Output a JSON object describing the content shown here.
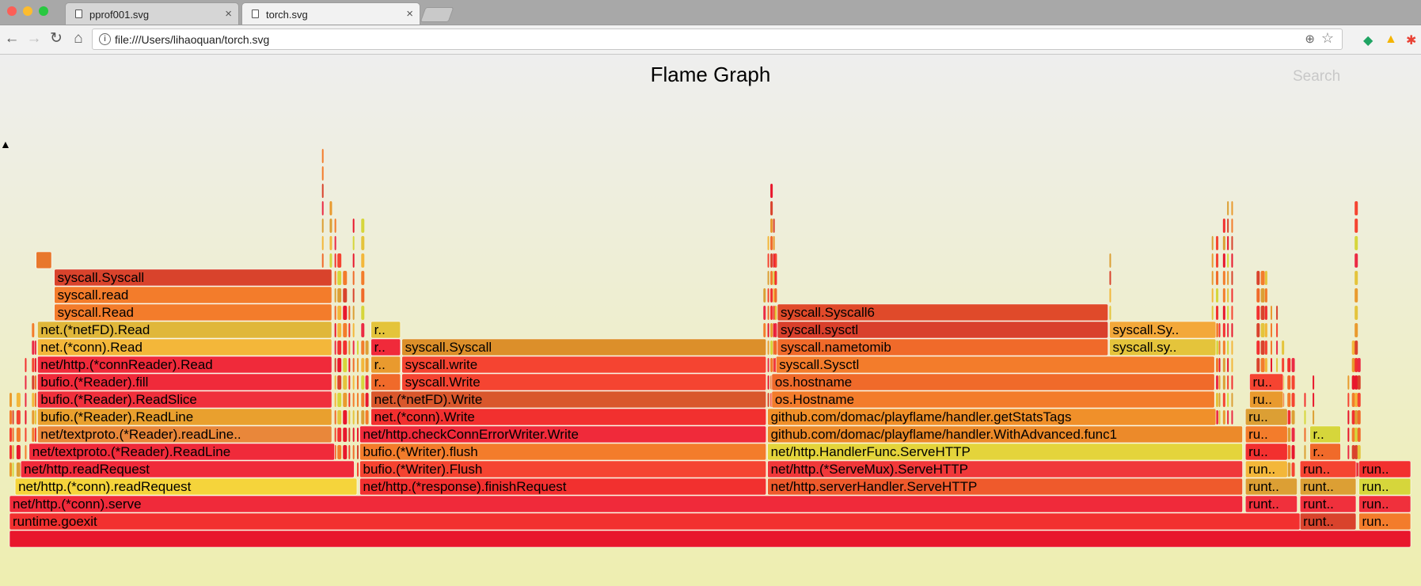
{
  "browser": {
    "tabs": [
      {
        "label": "pprof001.svg",
        "active": false
      },
      {
        "label": "torch.svg",
        "active": true
      }
    ],
    "url": "file:///Users/lihaoquan/torch.svg",
    "close_glyph": "×"
  },
  "flame": {
    "title": "Flame Graph",
    "search_label": "Search",
    "palette": [
      "#e8172c",
      "#f2302f",
      "#f54431",
      "#d9432c",
      "#f06a2a",
      "#f37c2b",
      "#e99a2e",
      "#dc9f34",
      "#f3b73a",
      "#e4c43b",
      "#d6d63b",
      "#eb2a44"
    ],
    "frames": [
      {
        "label": "",
        "level": 0,
        "start": 0.0,
        "width": 1.0,
        "color": "#e8172c"
      },
      {
        "label": "runtime.goexit",
        "level": 1,
        "start": 0.0,
        "width": 0.921,
        "color": "#f2302f"
      },
      {
        "label": "runt..",
        "level": 1,
        "start": 0.921,
        "width": 0.04,
        "color": "#d9432c"
      },
      {
        "label": "run..",
        "level": 1,
        "start": 0.963,
        "width": 0.037,
        "color": "#f37c2b"
      },
      {
        "label": "net/http.(*conn).serve",
        "level": 2,
        "start": 0.0,
        "width": 0.88,
        "color": "#f02a3a"
      },
      {
        "label": "runt..",
        "level": 2,
        "start": 0.882,
        "width": 0.037,
        "color": "#f0303c"
      },
      {
        "label": "runt..",
        "level": 2,
        "start": 0.921,
        "width": 0.04,
        "color": "#f0303c"
      },
      {
        "label": "run..",
        "level": 2,
        "start": 0.963,
        "width": 0.037,
        "color": "#f0303c"
      },
      {
        "label": "net/http.(*conn).readRequest",
        "level": 3,
        "start": 0.004,
        "width": 0.244,
        "color": "#f5d43b"
      },
      {
        "label": "net/http.(*response).finishRequest",
        "level": 3,
        "start": 0.25,
        "width": 0.29,
        "color": "#f2302f"
      },
      {
        "label": "net/http.serverHandler.ServeHTTP",
        "level": 3,
        "start": 0.541,
        "width": 0.339,
        "color": "#ef5a2c"
      },
      {
        "label": "runt..",
        "level": 3,
        "start": 0.882,
        "width": 0.037,
        "color": "#dc9f34"
      },
      {
        "label": "runt..",
        "level": 3,
        "start": 0.921,
        "width": 0.04,
        "color": "#dc9f34"
      },
      {
        "label": "run..",
        "level": 3,
        "start": 0.963,
        "width": 0.037,
        "color": "#d6d63b"
      },
      {
        "label": "net/http.readRequest",
        "level": 4,
        "start": 0.008,
        "width": 0.238,
        "color": "#f02a3a"
      },
      {
        "label": "bufio.(*Writer).Flush",
        "level": 4,
        "start": 0.25,
        "width": 0.29,
        "color": "#f54431"
      },
      {
        "label": "net/http.(*ServeMux).ServeHTTP",
        "level": 4,
        "start": 0.541,
        "width": 0.339,
        "color": "#f0383a"
      },
      {
        "label": "run..",
        "level": 4,
        "start": 0.882,
        "width": 0.03,
        "color": "#f3b73a"
      },
      {
        "label": "run..",
        "level": 4,
        "start": 0.921,
        "width": 0.04,
        "color": "#f54431"
      },
      {
        "label": "run..",
        "level": 4,
        "start": 0.963,
        "width": 0.037,
        "color": "#f2302f"
      },
      {
        "label": "net/textproto.(*Reader).ReadLine",
        "level": 5,
        "start": 0.014,
        "width": 0.218,
        "color": "#f02a3a"
      },
      {
        "label": "bufio.(*Writer).flush",
        "level": 5,
        "start": 0.25,
        "width": 0.29,
        "color": "#f37c2b"
      },
      {
        "label": "net/http.HandlerFunc.ServeHTTP",
        "level": 5,
        "start": 0.541,
        "width": 0.339,
        "color": "#e4d43b"
      },
      {
        "label": "ru..",
        "level": 5,
        "start": 0.882,
        "width": 0.03,
        "color": "#f2302f"
      },
      {
        "label": "r..",
        "level": 5,
        "start": 0.928,
        "width": 0.022,
        "color": "#f06a2a"
      },
      {
        "label": "net/textproto.(*Reader).readLine..",
        "level": 6,
        "start": 0.02,
        "width": 0.21,
        "color": "#e9873a"
      },
      {
        "label": "net/http.checkConnErrorWriter.Write",
        "level": 6,
        "start": 0.25,
        "width": 0.29,
        "color": "#f02a3a"
      },
      {
        "label": "github.com/domac/playflame/handler.WithAdvanced.func1",
        "level": 6,
        "start": 0.541,
        "width": 0.339,
        "color": "#ec8a2a"
      },
      {
        "label": "ru..",
        "level": 6,
        "start": 0.882,
        "width": 0.03,
        "color": "#f37c2b"
      },
      {
        "label": "r..",
        "level": 6,
        "start": 0.928,
        "width": 0.022,
        "color": "#d6d63b"
      },
      {
        "label": "bufio.(*Reader).ReadLine",
        "level": 7,
        "start": 0.02,
        "width": 0.21,
        "color": "#e9a02e"
      },
      {
        "label": "net.(*conn).Write",
        "level": 7,
        "start": 0.258,
        "width": 0.282,
        "color": "#f2302f"
      },
      {
        "label": "github.com/domac/playflame/handler.getStatsTags",
        "level": 7,
        "start": 0.541,
        "width": 0.32,
        "color": "#f0902a"
      },
      {
        "label": "ru..",
        "level": 7,
        "start": 0.882,
        "width": 0.03,
        "color": "#dc9f34"
      },
      {
        "label": "bufio.(*Reader).ReadSlice",
        "level": 8,
        "start": 0.02,
        "width": 0.21,
        "color": "#f0303c"
      },
      {
        "label": "net.(*netFD).Write",
        "level": 8,
        "start": 0.258,
        "width": 0.282,
        "color": "#d9572c"
      },
      {
        "label": "os.Hostname",
        "level": 8,
        "start": 0.544,
        "width": 0.316,
        "color": "#f37c2b"
      },
      {
        "label": "ru..",
        "level": 8,
        "start": 0.885,
        "width": 0.024,
        "color": "#e99a2e"
      },
      {
        "label": "bufio.(*Reader).fill",
        "level": 9,
        "start": 0.02,
        "width": 0.21,
        "color": "#f02a3a"
      },
      {
        "label": "r..",
        "level": 9,
        "start": 0.258,
        "width": 0.021,
        "color": "#f06a2a"
      },
      {
        "label": "syscall.Write",
        "level": 9,
        "start": 0.28,
        "width": 0.26,
        "color": "#f54431"
      },
      {
        "label": "os.hostname",
        "level": 9,
        "start": 0.544,
        "width": 0.316,
        "color": "#f06a2a"
      },
      {
        "label": "ru..",
        "level": 9,
        "start": 0.885,
        "width": 0.024,
        "color": "#f54431"
      },
      {
        "label": "net/http.(*connReader).Read",
        "level": 10,
        "start": 0.02,
        "width": 0.21,
        "color": "#f02a3a"
      },
      {
        "label": "r..",
        "level": 10,
        "start": 0.258,
        "width": 0.021,
        "color": "#e99a2e"
      },
      {
        "label": "syscall.write",
        "level": 10,
        "start": 0.28,
        "width": 0.26,
        "color": "#f54431"
      },
      {
        "label": "syscall.Sysctl",
        "level": 10,
        "start": 0.547,
        "width": 0.313,
        "color": "#f37c2b"
      },
      {
        "label": "net.(*conn).Read",
        "level": 11,
        "start": 0.02,
        "width": 0.21,
        "color": "#f3b73a"
      },
      {
        "label": "r..",
        "level": 11,
        "start": 0.258,
        "width": 0.021,
        "color": "#f02a3a"
      },
      {
        "label": "syscall.Syscall",
        "level": 11,
        "start": 0.28,
        "width": 0.26,
        "color": "#dc8f2a"
      },
      {
        "label": "syscall.nametomib",
        "level": 11,
        "start": 0.548,
        "width": 0.236,
        "color": "#f06a2a"
      },
      {
        "label": "syscall.sy..",
        "level": 11,
        "start": 0.785,
        "width": 0.076,
        "color": "#e4c43b"
      },
      {
        "label": "net.(*netFD).Read",
        "level": 12,
        "start": 0.02,
        "width": 0.21,
        "color": "#e0b73a"
      },
      {
        "label": "r..",
        "level": 12,
        "start": 0.258,
        "width": 0.021,
        "color": "#e4c43b"
      },
      {
        "label": "syscall.sysctl",
        "level": 12,
        "start": 0.548,
        "width": 0.236,
        "color": "#d9402c"
      },
      {
        "label": "syscall.Sy..",
        "level": 12,
        "start": 0.785,
        "width": 0.076,
        "color": "#f3a83a"
      },
      {
        "label": "syscall.Read",
        "level": 13,
        "start": 0.032,
        "width": 0.198,
        "color": "#f37c2b"
      },
      {
        "label": "syscall.Syscall6",
        "level": 13,
        "start": 0.548,
        "width": 0.236,
        "color": "#e04a2a"
      },
      {
        "label": "syscall.read",
        "level": 14,
        "start": 0.032,
        "width": 0.198,
        "color": "#f37c2b"
      },
      {
        "label": "syscall.Syscall",
        "level": 15,
        "start": 0.032,
        "width": 0.198,
        "color": "#d9432c"
      },
      {
        "label": "",
        "level": 16,
        "start": 0.019,
        "width": 0.011,
        "color": "#e8772c"
      }
    ]
  }
}
